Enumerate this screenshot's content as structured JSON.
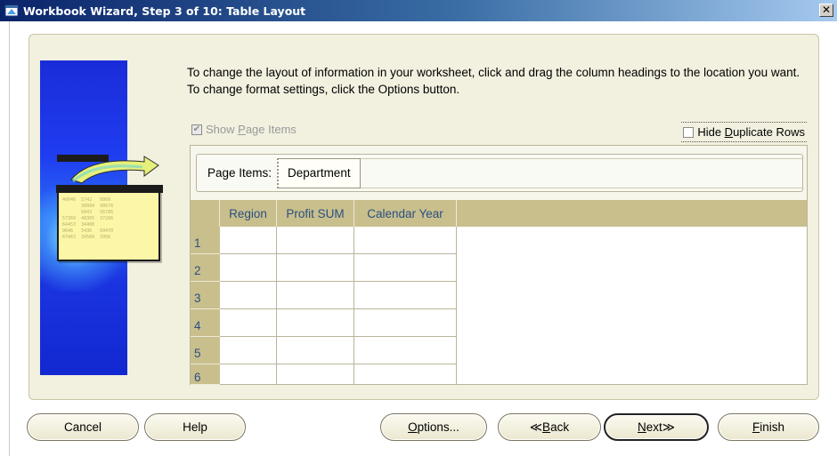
{
  "window": {
    "title": "Workbook Wizard, Step 3 of 10: Table Layout",
    "close_glyph": "✕"
  },
  "instructions": "To change the layout of information in your worksheet, click and drag the column headings to the location you want.  To change format settings, click the Options button.",
  "show_page_items": {
    "checked": true,
    "enabled": false,
    "label_pre": "Show ",
    "label_mn": "P",
    "label_post": "age Items"
  },
  "hide_duplicate_rows": {
    "checked": false,
    "label_pre": "Hide ",
    "label_mn": "D",
    "label_post": "uplicate Rows"
  },
  "page_items": {
    "label": "Page Items:",
    "item": "Department"
  },
  "table": {
    "columns": [
      "Region",
      "Profit SUM",
      "Calendar Year"
    ],
    "row_numbers": [
      "1",
      "2",
      "3",
      "4",
      "5",
      "6"
    ]
  },
  "buttons": {
    "cancel": "Cancel",
    "help": "Help",
    "options": {
      "mn": "O",
      "rest": "ptions..."
    },
    "back": {
      "arrow": "≪ ",
      "mn": "B",
      "rest": "ack"
    },
    "next": {
      "mn": "N",
      "rest": "ext",
      "arrow": " ≫"
    },
    "finish": {
      "mn": "F",
      "rest": "inish"
    }
  },
  "colors": {
    "title_start": "#0a246a",
    "header_bg": "#c8bf8c",
    "header_text": "#2c4f82",
    "panel_bg": "#f2f0df"
  }
}
